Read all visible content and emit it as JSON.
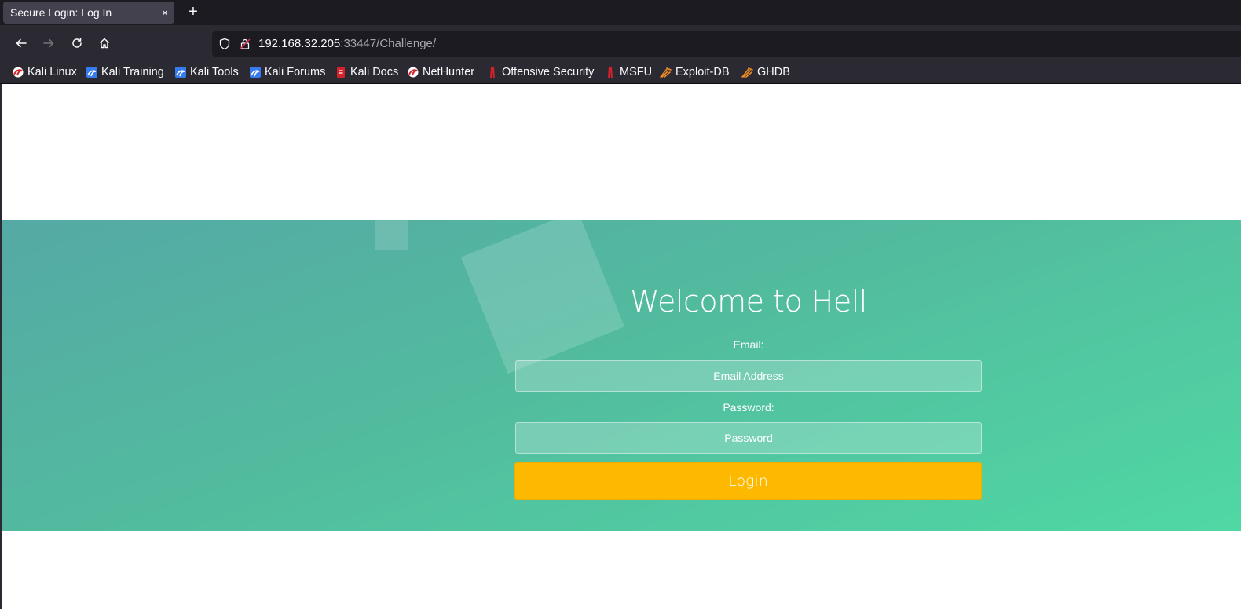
{
  "browser": {
    "tab_title": "Secure Login: Log In",
    "tab_close": "×",
    "new_tab": "+",
    "url_host": "192.168.32.205",
    "url_rest": ":33447/Challenge/"
  },
  "bookmarks": [
    {
      "label": "Kali Linux",
      "icon": "kali-dragon-icon"
    },
    {
      "label": "Kali Training",
      "icon": "kali-blue-icon"
    },
    {
      "label": "Kali Tools",
      "icon": "kali-blue-icon"
    },
    {
      "label": "Kali Forums",
      "icon": "kali-blue-icon"
    },
    {
      "label": "Kali Docs",
      "icon": "kali-docs-icon"
    },
    {
      "label": "NetHunter",
      "icon": "kali-dragon-icon"
    },
    {
      "label": "Offensive Security",
      "icon": "offsec-icon"
    },
    {
      "label": "MSFU",
      "icon": "offsec-icon"
    },
    {
      "label": "Exploit-DB",
      "icon": "exploitdb-icon"
    },
    {
      "label": "GHDB",
      "icon": "exploitdb-icon"
    }
  ],
  "login": {
    "title": "Welcome to Hell",
    "email_label": "Email:",
    "email_placeholder": "Email Address",
    "password_label": "Password:",
    "password_placeholder": "Password",
    "login_button": "Login"
  },
  "colors": {
    "accent": "#fdb900",
    "hero_start": "#55a9a5",
    "hero_end": "#50d8a4"
  }
}
